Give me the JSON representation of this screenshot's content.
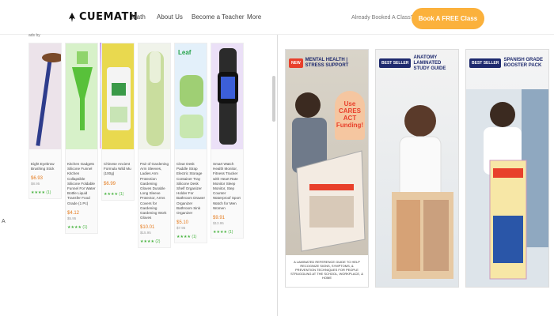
{
  "nav": {
    "logo": "CUEMATH",
    "links": [
      "Math",
      "About Us",
      "Become a Teacher",
      "More"
    ],
    "booked_text": "Already Booked A Class?",
    "cta": "Book A FREE Class"
  },
  "left_panel": {
    "cut_label": "ads by",
    "edge_char": "A",
    "products": [
      {
        "title": "Eight Eyebrow Brushing Stick",
        "price": "$6.93",
        "old": "$8.95",
        "stars": "★★★★ (1)"
      },
      {
        "title": "Kitchen Gadgets Silicone Funnel Kitchen Collapsible Silicone Foldable Funnel For Water Bottle Liquid Transfer Food Grade (1 Pc)",
        "price": "$4.12",
        "old": "$5.95",
        "stars": "★★★★ (1)"
      },
      {
        "title": "Chinese Ancient Formula Wild Mu (100g)",
        "price": "$6.99",
        "old": "",
        "stars": "★★★★ (1)"
      },
      {
        "title": "Pair of Gardening Arm Sleeves, Ladies Arm Protection Gardening Gloves Durable Long Sleeve Protector, Arms Covers for Gardening Gardening Work Gloves",
        "price": "$10.01",
        "old": "$15.95",
        "stars": "★★★★ (2)"
      },
      {
        "title": "Clear Desk Paddle Strap Electric Storage Container Tray Silicone Desk Shelf Organizer Holder For Bathroom Drawer Organizer Bathroom Sink Organizer",
        "price": "$5.10",
        "old": "$7.95",
        "stars": "★★★★ (1)"
      },
      {
        "title": "Smart Watch Health Monitor, Fitness Tracker with Heart Rate Monitor Sleep Monitor, Step Counter Waterproof Sport Watch for Men Women",
        "price": "$9.91",
        "old": "$13.95",
        "stars": "★★★★ (1)"
      }
    ]
  },
  "ads": [
    {
      "badge": "NEW",
      "title": "MENTAL HEALTH | STRESS SUPPORT",
      "callout": "Use CARES ACT Funding!",
      "footer": "A LAMINATED REFERENCE GUIDE TO HELP RECOGNIZE SIGNS, SYMPTOMS, & PREVENTION TECHNIQUES FOR PEOPLE STRUGGLING AT THE SCHOOL, WORKPLACE, & HOME"
    },
    {
      "badge": "BEST SELLER",
      "title": "ANATOMY LAMINATED STUDY GUIDE",
      "callout": "",
      "footer": ""
    },
    {
      "badge": "BEST SELLER",
      "title": "SPANISH GRADE BOOSTER PACK",
      "callout": "",
      "footer": ""
    }
  ],
  "colors": {
    "accent": "#fbb13c",
    "ad_navy": "#1e2a6e",
    "ad_red": "#e8402b",
    "price": "#e57b1e",
    "stars": "#4bb543"
  }
}
